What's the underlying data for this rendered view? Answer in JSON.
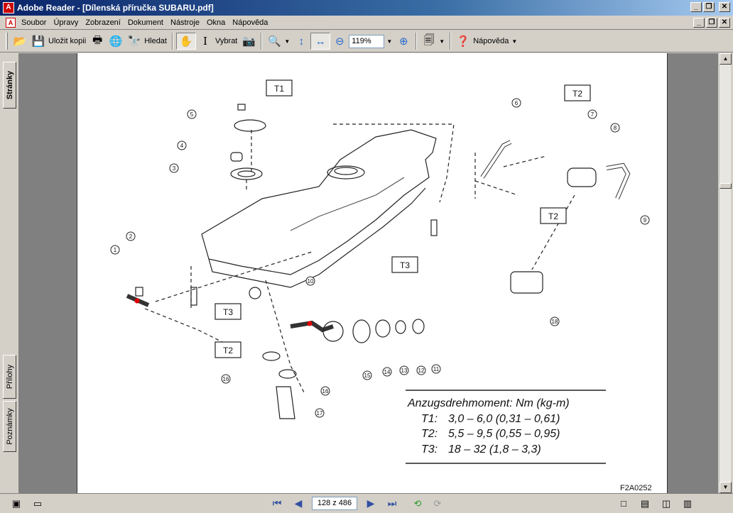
{
  "window": {
    "title": "Adobe Reader - [Dílenská příručka SUBARU.pdf]"
  },
  "menu": [
    "Soubor",
    "Úpravy",
    "Zobrazení",
    "Dokument",
    "Nástroje",
    "Okna",
    "Nápověda"
  ],
  "toolbar": {
    "save_copy_label": "Uložit kopii",
    "search_label": "Hledat",
    "select_label": "Vybrat",
    "zoom_value": "119%",
    "help_label": "Nápověda"
  },
  "left_tabs": {
    "pages": "Stránky",
    "attachments": "Přílohy",
    "notes": "Poznámky"
  },
  "status": {
    "page_indicator": "128 z 486"
  },
  "diagram": {
    "callouts": [
      "T1",
      "T2",
      "T2",
      "T3",
      "T3",
      "T2"
    ],
    "part_numbers": [
      "1",
      "2",
      "3",
      "4",
      "5",
      "6",
      "7",
      "8",
      "9",
      "10",
      "11",
      "12",
      "13",
      "14",
      "15",
      "16",
      "16",
      "17",
      "18"
    ],
    "torque_title": "Anzugsdrehmoment: Nm (kg-m)",
    "torque_rows": [
      {
        "label": "T1:",
        "value": "3,0 – 6,0 (0,31 – 0,61)"
      },
      {
        "label": "T2:",
        "value": "5,5 – 9,5 (0,55 – 0,95)"
      },
      {
        "label": "T3:",
        "value": "18 – 32 (1,8 – 3,3)"
      }
    ],
    "figure_code": "F2A0252"
  }
}
